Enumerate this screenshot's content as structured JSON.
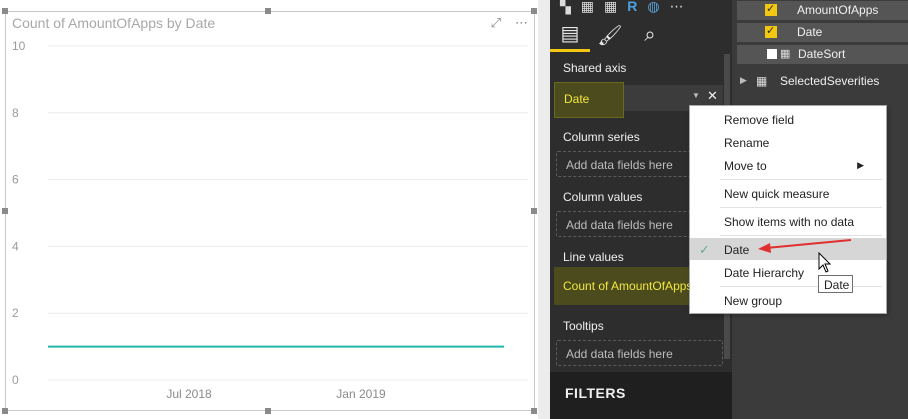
{
  "chart": {
    "title": "Count of AmountOfApps by Date",
    "focus_icon": "focus-mode-icon",
    "more_icon": "more-options-icon"
  },
  "chart_data": {
    "type": "line",
    "title": "Count of AmountOfApps by Date",
    "xlabel": "",
    "ylabel": "",
    "x_ticks": [
      "Jul 2018",
      "Jan 2019"
    ],
    "y_ticks": [
      "0",
      "2",
      "4",
      "6",
      "8",
      "10"
    ],
    "ylim": [
      0,
      10
    ],
    "grid": true,
    "series": [
      {
        "name": "Count of AmountOfApps",
        "color": "#1fb8a8",
        "values": [
          1,
          1
        ]
      }
    ]
  },
  "viz_pane": {
    "icons": [
      "card-icon",
      "table-icon",
      "matrix-icon",
      "r-visual-icon",
      "globe-icon",
      "more-icon"
    ],
    "r_label": "R",
    "tabs": [
      "fields-tab-icon",
      "format-tab-icon",
      "analytics-tab-icon"
    ],
    "shared_axis": {
      "label": "Shared axis",
      "value": "Date"
    },
    "column_series": {
      "label": "Column series",
      "placeholder": "Add data fields here"
    },
    "column_values": {
      "label": "Column values",
      "placeholder": "Add data fields here"
    },
    "line_values": {
      "label": "Line values",
      "value": "Count of AmountOfApps"
    },
    "tooltips": {
      "label": "Tooltips",
      "placeholder": "Add data fields here"
    },
    "filters_label": "FILTERS"
  },
  "fields_pane": {
    "rows": [
      {
        "label": "AmountOfApps",
        "checked": true
      },
      {
        "label": "Date",
        "checked": true
      },
      {
        "label": "DateSort",
        "checked": false
      }
    ],
    "tables": [
      {
        "label": "SelectedSeverities"
      }
    ]
  },
  "context_menu": {
    "items": [
      {
        "label": "Remove field"
      },
      {
        "label": "Rename"
      },
      {
        "label": "Move to"
      },
      {
        "label": "New quick measure"
      },
      {
        "label": "Show items with no data"
      },
      {
        "label": "Date",
        "checked": true
      },
      {
        "label": "Date Hierarchy"
      },
      {
        "label": "New group"
      }
    ],
    "tooltip": "Date"
  },
  "colors": {
    "accent": "#f2c811",
    "line": "#1fb8a8",
    "highlight_yellow": "#ffff00",
    "annotation_arrow": "#e03030"
  }
}
